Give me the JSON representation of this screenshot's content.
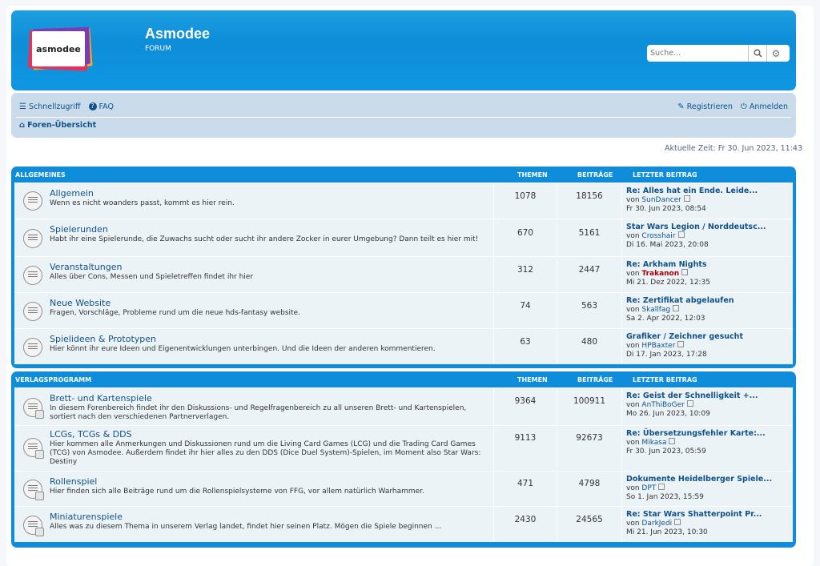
{
  "header": {
    "logo_text": "asmodee",
    "site_title": "Asmodee",
    "site_subtitle": "FORUM",
    "search_placeholder": "Suche...",
    "search_icon": "search-icon",
    "advanced_search_icon": "gear-icon"
  },
  "navbar": {
    "quicklinks": "Schnellzugriff",
    "faq": "FAQ",
    "register": "Registrieren",
    "login": "Anmelden",
    "breadcrumb": "Foren-Übersicht"
  },
  "current_time": "Aktuelle Zeit: Fr 30. Jun 2023, 11:43",
  "categories": [
    {
      "name": "ALLGEMEINES",
      "col_topics": "THEMEN",
      "col_posts": "BEITRÄGE",
      "col_last": "LETZTER BEITRAG",
      "forums": [
        {
          "title": "Allgemein",
          "desc": "Wenn es nicht woanders passt, kommt es hier rein.",
          "topics": "1078",
          "posts": "18156",
          "last_title": "Re: Alles hat ein Ende. Leide...",
          "by": "von",
          "last_user": "SunDancer",
          "last_date": "Fr 30. Jun 2023, 08:54"
        },
        {
          "title": "Spielerunden",
          "desc": "Habt ihr eine Spielerunde, die Zuwachs sucht oder sucht ihr andere Zocker in eurer Umgebung? Dann teilt es hier mit!",
          "topics": "670",
          "posts": "5161",
          "last_title": "Star Wars Legion / Norddeutsc...",
          "by": "von",
          "last_user": "Crosshair",
          "last_date": "Di 16. Mai 2023, 20:08"
        },
        {
          "title": "Veranstaltungen",
          "desc": "Alles über Cons, Messen und Spieletreffen findet ihr hier",
          "topics": "312",
          "posts": "2447",
          "last_title": "Re: Arkham Nights",
          "by": "von",
          "last_user": "Trakanon",
          "last_date": "Mi 21. Dez 2022, 12:35"
        },
        {
          "title": "Neue Website",
          "desc": "Fragen, Vorschläge, Probleme rund um die neue hds-fantasy website.",
          "topics": "74",
          "posts": "563",
          "last_title": "Re: Zertifikat abgelaufen",
          "by": "von",
          "last_user": "Skallfag",
          "last_date": "Sa 2. Apr 2022, 12:03"
        },
        {
          "title": "Spielideen & Prototypen",
          "desc": "Hier könnt ihr eure Ideen und Eigenentwicklungen unterbingen. Und die Ideen der anderen kommentieren.",
          "topics": "63",
          "posts": "480",
          "last_title": "Grafiker / Zeichner gesucht",
          "by": "von",
          "last_user": "HPBaxter",
          "last_date": "Di 17. Jan 2023, 17:28"
        }
      ]
    },
    {
      "name": "VERLAGSPROGRAMM",
      "col_topics": "THEMEN",
      "col_posts": "BEITRÄGE",
      "col_last": "LETZTER BEITRAG",
      "forums": [
        {
          "title": "Brett- und Kartenspiele",
          "desc": "In diesem Forenbereich findet ihr den Diskussions- und Regelfragenbereich zu all unseren Brett- und Kartenspielen, sortiert nach den verschiedenen Partnerverlagen.",
          "topics": "9364",
          "posts": "100911",
          "last_title": "Re: Geist der Schnelligkeit +...",
          "by": "von",
          "last_user": "AnThiBoGer",
          "last_date": "Mo 26. Jun 2023, 10:09"
        },
        {
          "title": "LCGs, TCGs & DDS",
          "desc": "Hier kommen alle Anmerkungen und Diskussionen rund um die Living Card Games (LCG) und die Trading Card Games (TCG) von Asmodee. Außerdem findet ihr hier alles zu den DDS (Dice Duel System)-Spielen, im Moment also Star Wars: Destiny",
          "topics": "9113",
          "posts": "92673",
          "last_title": "Re: Übersetzungsfehler Karte:...",
          "by": "von",
          "last_user": "Mikasa",
          "last_date": "Fr 30. Jun 2023, 05:59"
        },
        {
          "title": "Rollenspiel",
          "desc": "Hier finden sich alle Beiträge rund um die Rollenspielsysteme von FFG, vor allem natürlich Warhammer.",
          "topics": "471",
          "posts": "4798",
          "last_title": "Dokumente Heidelberger Spiele...",
          "by": "von",
          "last_user": "DPT",
          "last_date": "So 1. Jan 2023, 15:59"
        },
        {
          "title": "Miniaturenspiele",
          "desc": "Alles was zu diesem Thema in unserem Verlag landet, findet hier seinen Platz. Mögen die Spiele beginnen ...",
          "topics": "2430",
          "posts": "24565",
          "last_title": "Re: Star Wars Shatterpoint Pr...",
          "by": "von",
          "last_user": "DarkJedi",
          "last_date": "Mi 21. Jun 2023, 10:30"
        }
      ]
    }
  ]
}
